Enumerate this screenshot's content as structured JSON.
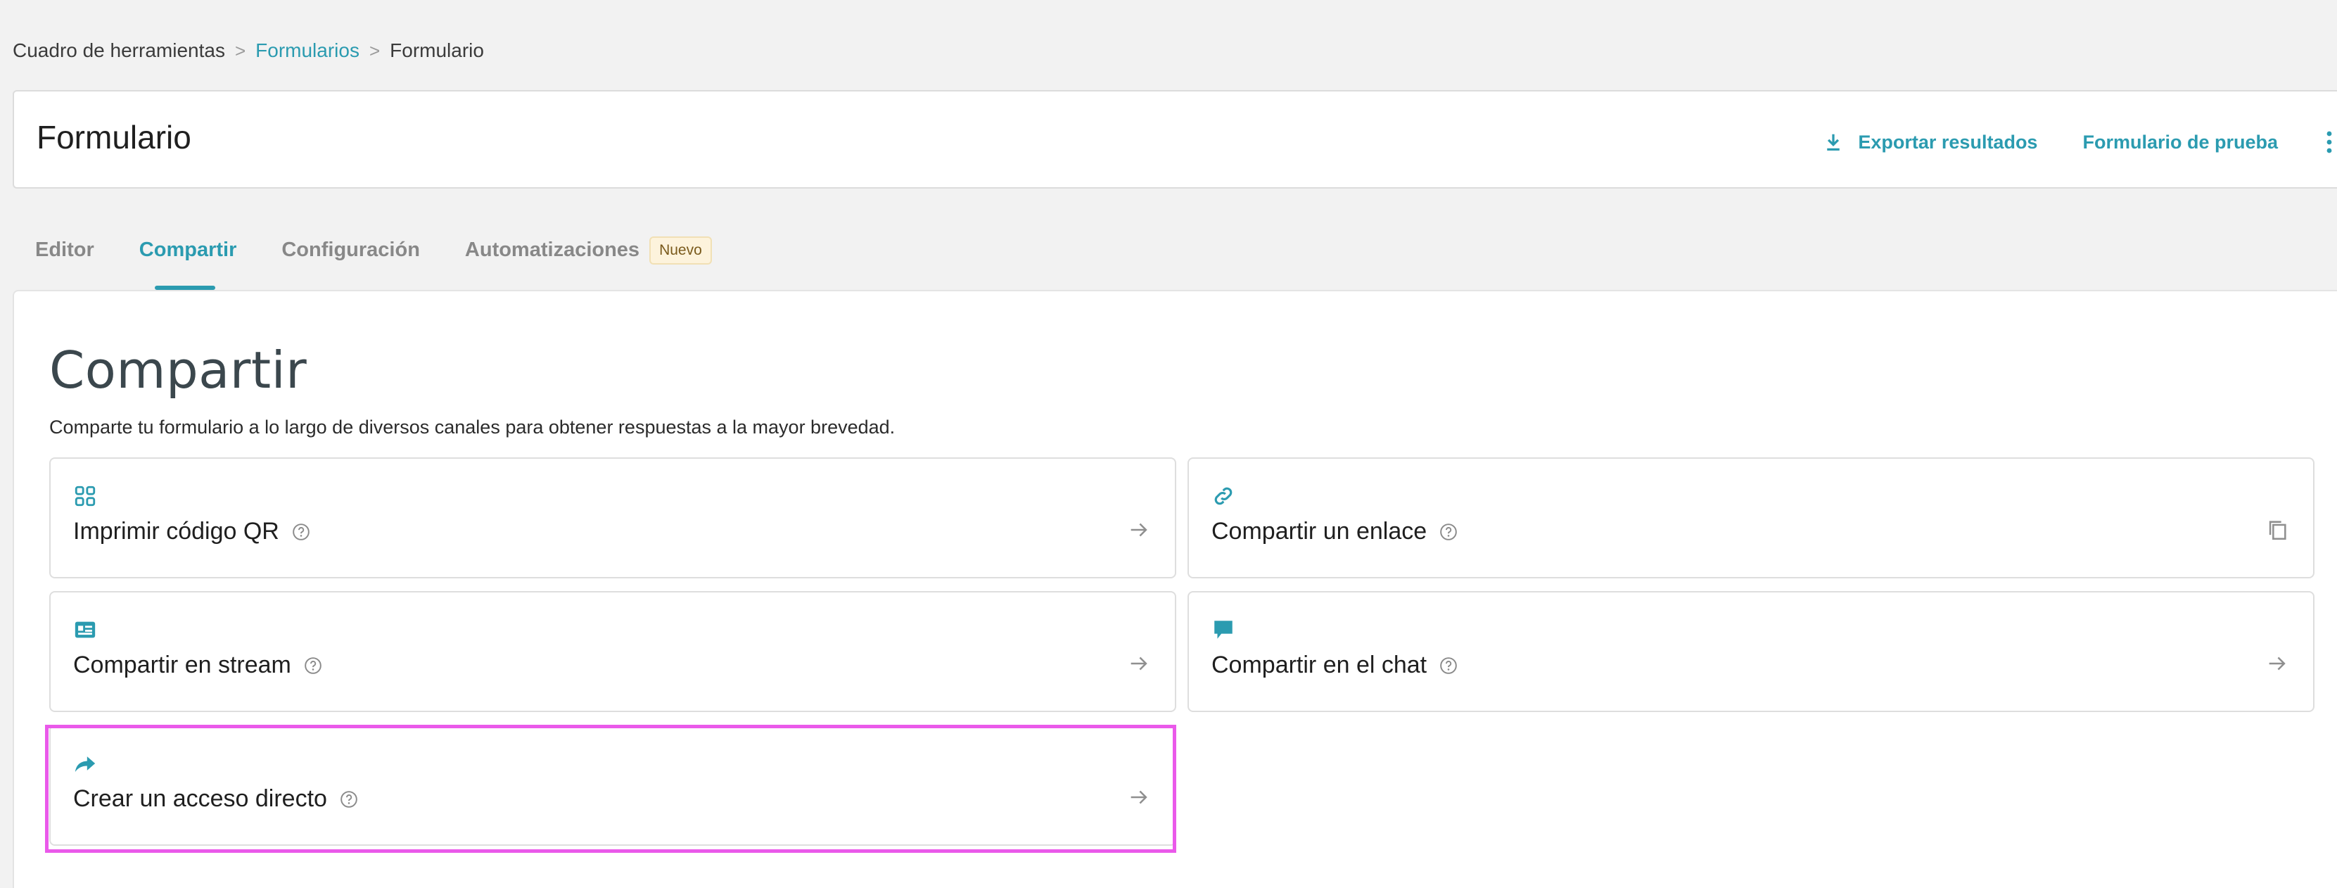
{
  "breadcrumb": {
    "item1": "Cuadro de herramientas",
    "sep1": ">",
    "item2": "Formularios",
    "sep2": ">",
    "item3": "Formulario"
  },
  "header": {
    "title": "Formulario",
    "export_label": "Exportar resultados",
    "test_label": "Formulario de prueba"
  },
  "tabs": [
    {
      "label": "Editor"
    },
    {
      "label": "Compartir"
    },
    {
      "label": "Configuración"
    },
    {
      "label": "Automatizaciones",
      "badge": "Nuevo"
    }
  ],
  "main": {
    "title": "Compartir",
    "subtitle": "Comparte tu formulario a lo largo de diversos canales para obtener respuestas a la mayor brevedad.",
    "cards": [
      {
        "label": "Imprimir código QR",
        "icon": "qr-grid-icon",
        "trail": "arrow-right-icon"
      },
      {
        "label": "Compartir un enlace",
        "icon": "link-icon",
        "trail": "copy-icon"
      },
      {
        "label": "Compartir en stream",
        "icon": "stream-icon",
        "trail": "arrow-right-icon"
      },
      {
        "label": "Compartir en el chat",
        "icon": "chat-bubble-icon",
        "trail": "arrow-right-icon"
      },
      {
        "label": "Crear un acceso directo",
        "icon": "share-forward-icon",
        "trail": "arrow-right-icon"
      }
    ]
  },
  "colors": {
    "accent": "#2b9bb0",
    "highlight": "#ea59ea",
    "badge_bg": "#fdf3dc"
  }
}
